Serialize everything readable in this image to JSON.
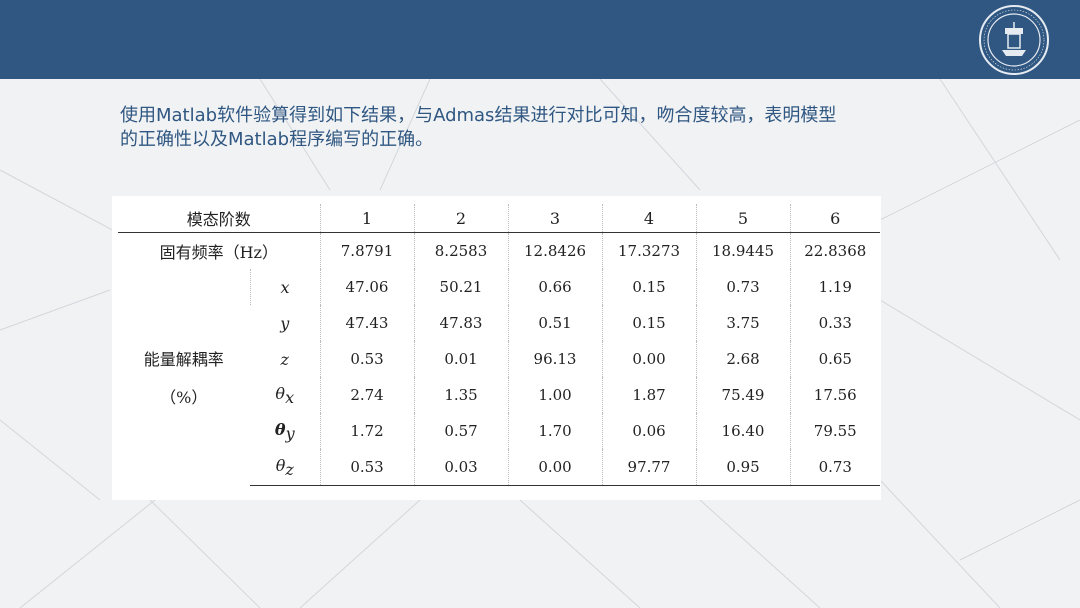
{
  "slide": {
    "intro_text": "使用Matlab软件验算得到如下结果，与Admas结果进行对比可知，吻合度较高，表明模型的正确性以及Matlab程序编写的正确。"
  },
  "colors": {
    "header": "#2f5782",
    "text_accent": "#2f5782",
    "background": "#f1f2f4"
  },
  "table": {
    "header_label": "模态阶数",
    "modes": [
      "1",
      "2",
      "3",
      "4",
      "5",
      "6"
    ],
    "freq_label": "固有频率（Hz）",
    "frequencies": [
      "7.8791",
      "8.2583",
      "12.8426",
      "17.3273",
      "18.9445",
      "22.8368"
    ],
    "group_label_line1": "能量解耦率",
    "group_label_line2": "（%）",
    "rows": [
      {
        "symbol": "x",
        "sub": "",
        "values": [
          "47.06",
          "50.21",
          "0.66",
          "0.15",
          "0.73",
          "1.19"
        ]
      },
      {
        "symbol": "y",
        "sub": "",
        "values": [
          "47.43",
          "47.83",
          "0.51",
          "0.15",
          "3.75",
          "0.33"
        ]
      },
      {
        "symbol": "z",
        "sub": "",
        "values": [
          "0.53",
          "0.01",
          "96.13",
          "0.00",
          "2.68",
          "0.65"
        ]
      },
      {
        "symbol": "θ",
        "sub": "x",
        "values": [
          "2.74",
          "1.35",
          "1.00",
          "1.87",
          "75.49",
          "17.56"
        ]
      },
      {
        "symbol": "θ",
        "sub": "y",
        "values": [
          "1.72",
          "0.57",
          "1.70",
          "0.06",
          "16.40",
          "79.55"
        ]
      },
      {
        "symbol": "θ",
        "sub": "z",
        "values": [
          "0.53",
          "0.03",
          "0.00",
          "97.77",
          "0.95",
          "0.73"
        ]
      }
    ]
  }
}
